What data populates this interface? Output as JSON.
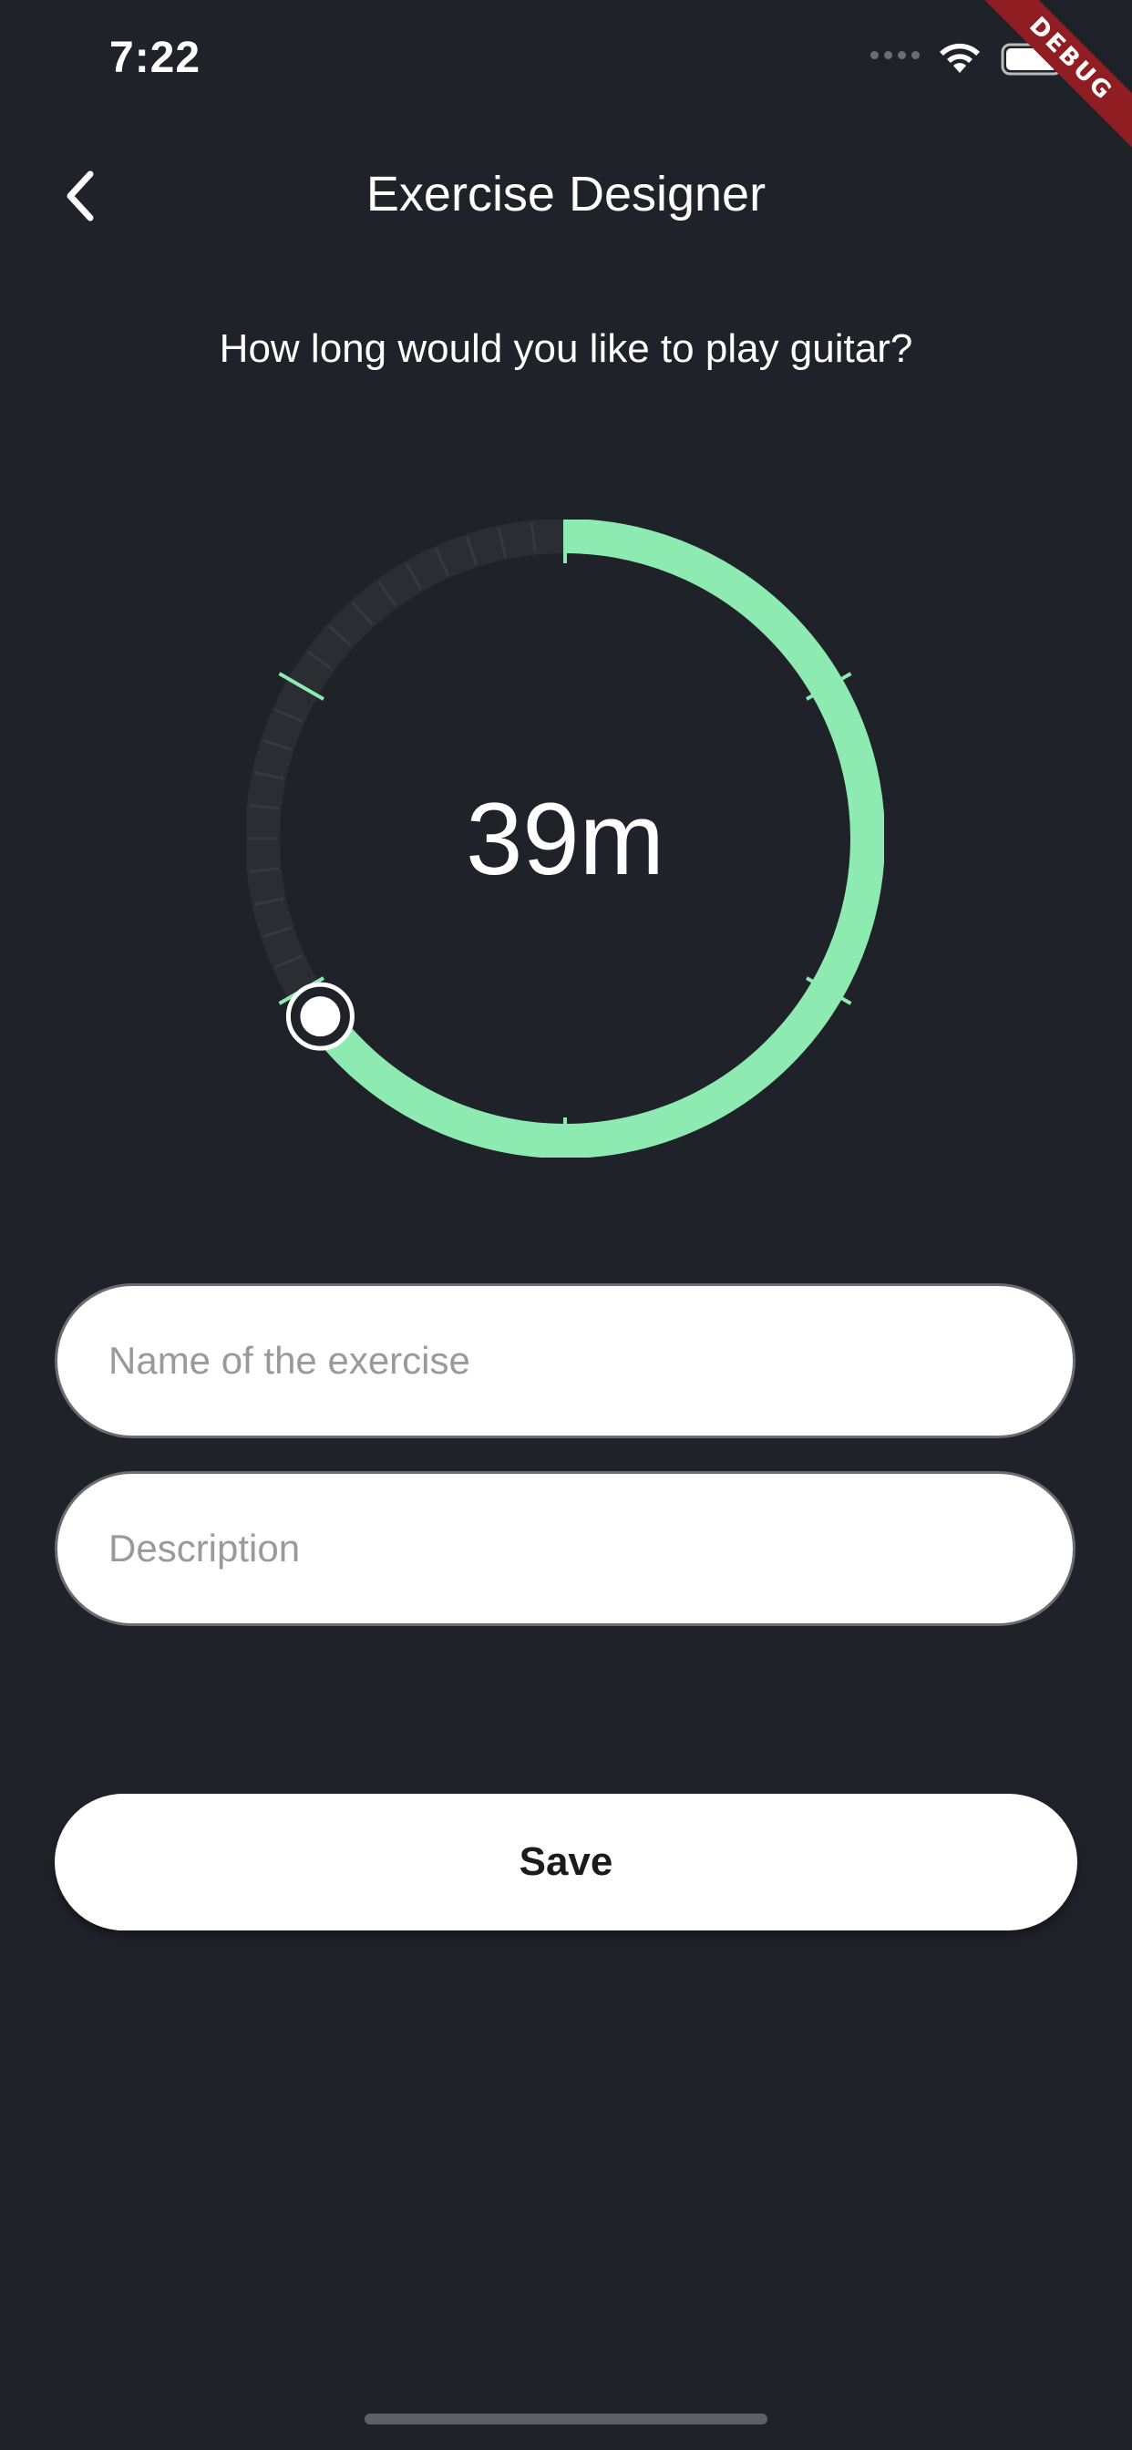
{
  "status_bar": {
    "time": "7:22"
  },
  "debug_banner": "DEBUG",
  "header": {
    "title": "Exercise Designer"
  },
  "prompt": "How long would you like to play guitar?",
  "timer": {
    "value_label": "39m",
    "minutes": 39,
    "max_minutes": 60,
    "progress_fraction": 0.65
  },
  "form": {
    "name_placeholder": "Name of the exercise",
    "description_placeholder": "Description",
    "name_value": "",
    "description_value": ""
  },
  "actions": {
    "save_label": "Save"
  },
  "colors": {
    "background": "#20222a",
    "accent": "#8deab1",
    "track": "#2a2e33",
    "debug": "#8f1d21"
  },
  "icons": [
    "back-icon",
    "wifi-icon",
    "battery-icon",
    "signal-icon"
  ]
}
